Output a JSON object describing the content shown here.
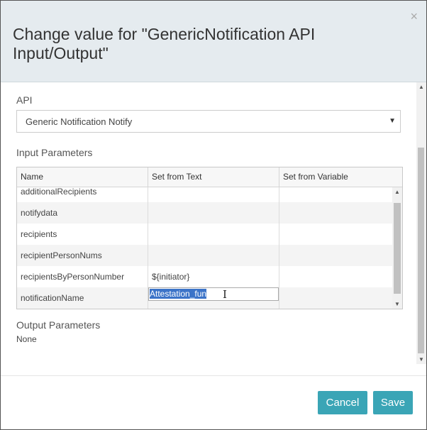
{
  "dialog": {
    "title": "Change value for \"GenericNotification API Input/Output\"",
    "close_label": "×"
  },
  "api": {
    "label": "API",
    "selected": "Generic Notification Notify",
    "arrow": "▼"
  },
  "input_parameters": {
    "label": "Input Parameters",
    "columns": [
      "Name",
      "Set from Text",
      "Set from Variable"
    ],
    "rows": [
      {
        "name": "additionalRecipients",
        "text": "",
        "variable": ""
      },
      {
        "name": "notifydata",
        "text": "",
        "variable": ""
      },
      {
        "name": "recipients",
        "text": "",
        "variable": ""
      },
      {
        "name": "recipientPersonNums",
        "text": "",
        "variable": ""
      },
      {
        "name": "recipientsByPersonNumber",
        "text": "${initiator}",
        "variable": ""
      },
      {
        "name": "notificationName",
        "text": "Attestation_fun",
        "variable": ""
      }
    ]
  },
  "output_parameters": {
    "label": "Output Parameters",
    "value": "None"
  },
  "scroll": {
    "up": "▲",
    "down": "▼"
  },
  "buttons": {
    "cancel": "Cancel",
    "save": "Save"
  },
  "colors": {
    "header_bg": "#e5ebef",
    "button": "#3aa5b6",
    "selection": "#3b73c8"
  }
}
